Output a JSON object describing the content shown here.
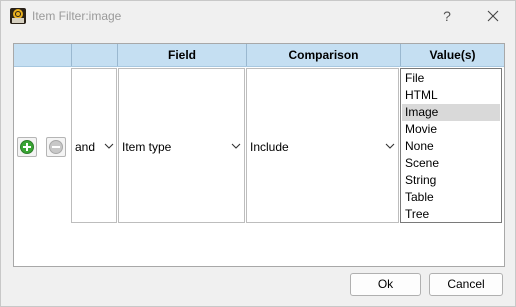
{
  "window": {
    "title": "Item Filter:image",
    "help_label": "?"
  },
  "table": {
    "headers": {
      "field": "Field",
      "comparison": "Comparison",
      "values": "Value(s)"
    },
    "row": {
      "conjunction": "and",
      "field": "Item type",
      "comparison": "Include",
      "values": [
        "File",
        "HTML",
        "Image",
        "Movie",
        "None",
        "Scene",
        "String",
        "Table",
        "Tree"
      ],
      "selected_value": "Image"
    }
  },
  "buttons": {
    "ok": "Ok",
    "cancel": "Cancel"
  },
  "colors": {
    "header_bg": "#c5dff2",
    "add_icon": "#3aa535",
    "remove_icon": "#c8c8c8",
    "selected_bg": "#d9d9d9"
  },
  "icons": {
    "app": "app-logo-icon",
    "help": "help-icon",
    "close": "close-icon",
    "add": "add-row-icon",
    "remove": "remove-row-icon",
    "dropdown": "chevron-down-icon"
  }
}
